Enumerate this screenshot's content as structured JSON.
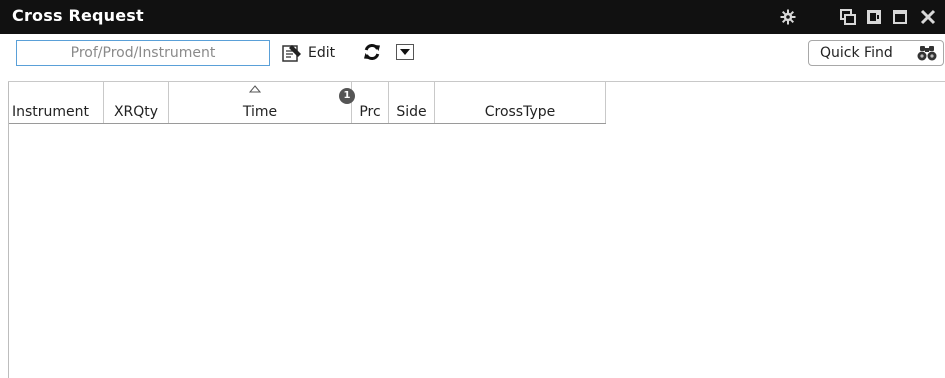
{
  "window": {
    "title": "Cross Request",
    "controls": [
      "gear-icon",
      "restore-icon",
      "pin-icon",
      "maximize-icon",
      "close-icon"
    ]
  },
  "toolbar": {
    "search_placeholder": "Prof/Prod/Instrument",
    "search_value": "",
    "edit_label": "Edit",
    "quick_find_label": "Quick Find",
    "icons": {
      "edit": "edit-icon",
      "refresh": "refresh-icon",
      "dropdown": "chevron-down-icon",
      "quick_find": "binoculars-icon"
    }
  },
  "grid": {
    "columns": [
      "Instrument",
      "XRQty",
      "Time",
      "Prc",
      "Side",
      "CrossType"
    ],
    "sorted_column": "Time",
    "sort_direction": "ascending",
    "sort_priority": "1",
    "rows": []
  },
  "colors": {
    "titlebar_bg": "#111111",
    "search_border": "#5aa0d8",
    "badge_bg": "#555555"
  }
}
